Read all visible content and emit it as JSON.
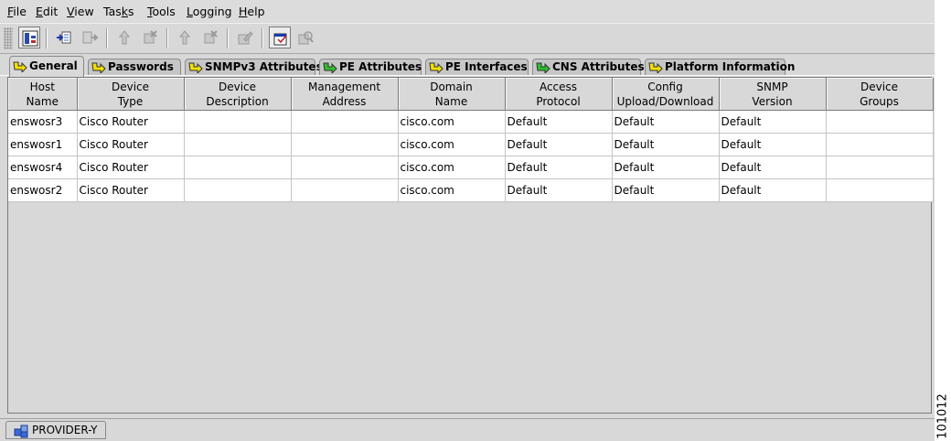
{
  "menu": [
    {
      "label": "File",
      "hotkey": "F",
      "rest": "ile"
    },
    {
      "label": "Edit",
      "hotkey": "E",
      "rest": "dit"
    },
    {
      "label": "View",
      "hotkey": "V",
      "rest": "iew"
    },
    {
      "label": "Tasks",
      "pre": "Tas",
      "hotkey": "k",
      "rest": "s"
    },
    {
      "label": "Tools",
      "hotkey": "T",
      "rest": "ools"
    },
    {
      "label": "Logging",
      "hotkey": "L",
      "rest": "ogging"
    },
    {
      "label": "Help",
      "hotkey": "H",
      "rest": "elp"
    }
  ],
  "toolbar": {
    "icons": [
      "device-view-icon",
      "import-icon",
      "export-icon",
      "move-up-icon",
      "remove-icon",
      "move-up-disabled-icon",
      "remove-disabled-icon",
      "edit-icon",
      "properties-icon",
      "audit-icon"
    ]
  },
  "tabs": [
    {
      "label": "General",
      "icon_color": "#f5e000",
      "active": true
    },
    {
      "label": "Passwords",
      "icon_color": "#f5e000"
    },
    {
      "label": "SNMPv3 Attributes",
      "icon_color": "#f5e000"
    },
    {
      "label": "PE Attributes",
      "icon_color": "#2dbf2d"
    },
    {
      "label": "PE Interfaces",
      "icon_color": "#f5e000"
    },
    {
      "label": "CNS Attributes",
      "icon_color": "#2dbf2d"
    },
    {
      "label": "Platform Information",
      "icon_color": "#f5e000"
    }
  ],
  "table": {
    "columns": [
      "Host\nName",
      "Device\nType",
      "Device\nDescription",
      "Management\nAddress",
      "Domain\nName",
      "Access\nProtocol",
      "Config\nUpload/Download",
      "SNMP\nVersion",
      "Device\nGroups"
    ],
    "rows": [
      [
        "enswosr3",
        "Cisco Router",
        "",
        "",
        "cisco.com",
        "Default",
        "Default",
        "Default",
        ""
      ],
      [
        "enswosr1",
        "Cisco Router",
        "",
        "",
        "cisco.com",
        "Default",
        "Default",
        "Default",
        ""
      ],
      [
        "enswosr4",
        "Cisco Router",
        "",
        "",
        "cisco.com",
        "Default",
        "Default",
        "Default",
        ""
      ],
      [
        "enswosr2",
        "Cisco Router",
        "",
        "",
        "cisco.com",
        "Default",
        "Default",
        "Default",
        ""
      ]
    ]
  },
  "status": {
    "provider": "PROVIDER-Y"
  },
  "figure_id": "101012"
}
